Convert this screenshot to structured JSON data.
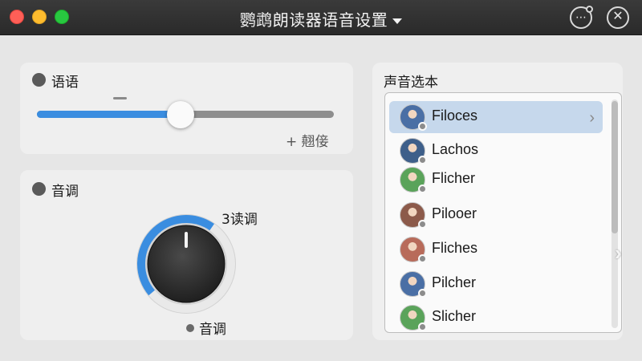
{
  "window": {
    "title": "鹦鹉朗读器语音设置",
    "more_label": "⋯",
    "close_label": "✕"
  },
  "speed": {
    "label": "语语",
    "minus_label": "—",
    "plus_label": "+ 翹倿",
    "value_fraction": 0.48
  },
  "pitch": {
    "label": "音调",
    "knob_value_label": "3读调",
    "knob_caption": "音调",
    "knob_fraction": 0.55
  },
  "voices": {
    "title": "声音选本",
    "items": [
      {
        "label": "Filoces",
        "avatar_color": "#4a6fa5",
        "selected": true
      },
      {
        "label": "Lachos",
        "avatar_color": "#3e5f8a",
        "selected": false
      },
      {
        "label": "Flicher",
        "avatar_color": "#5aa35a",
        "selected": false
      },
      {
        "label": "Pilooer",
        "avatar_color": "#8c5a4a",
        "selected": false
      },
      {
        "label": "Fliches",
        "avatar_color": "#b86b5a",
        "selected": false
      },
      {
        "label": "Pilcher",
        "avatar_color": "#4a6fa5",
        "selected": false
      },
      {
        "label": "Slicher",
        "avatar_color": "#5aa35a",
        "selected": false
      }
    ]
  },
  "colors": {
    "accent": "#3a8de0",
    "selected_row": "#c6d8ec"
  }
}
